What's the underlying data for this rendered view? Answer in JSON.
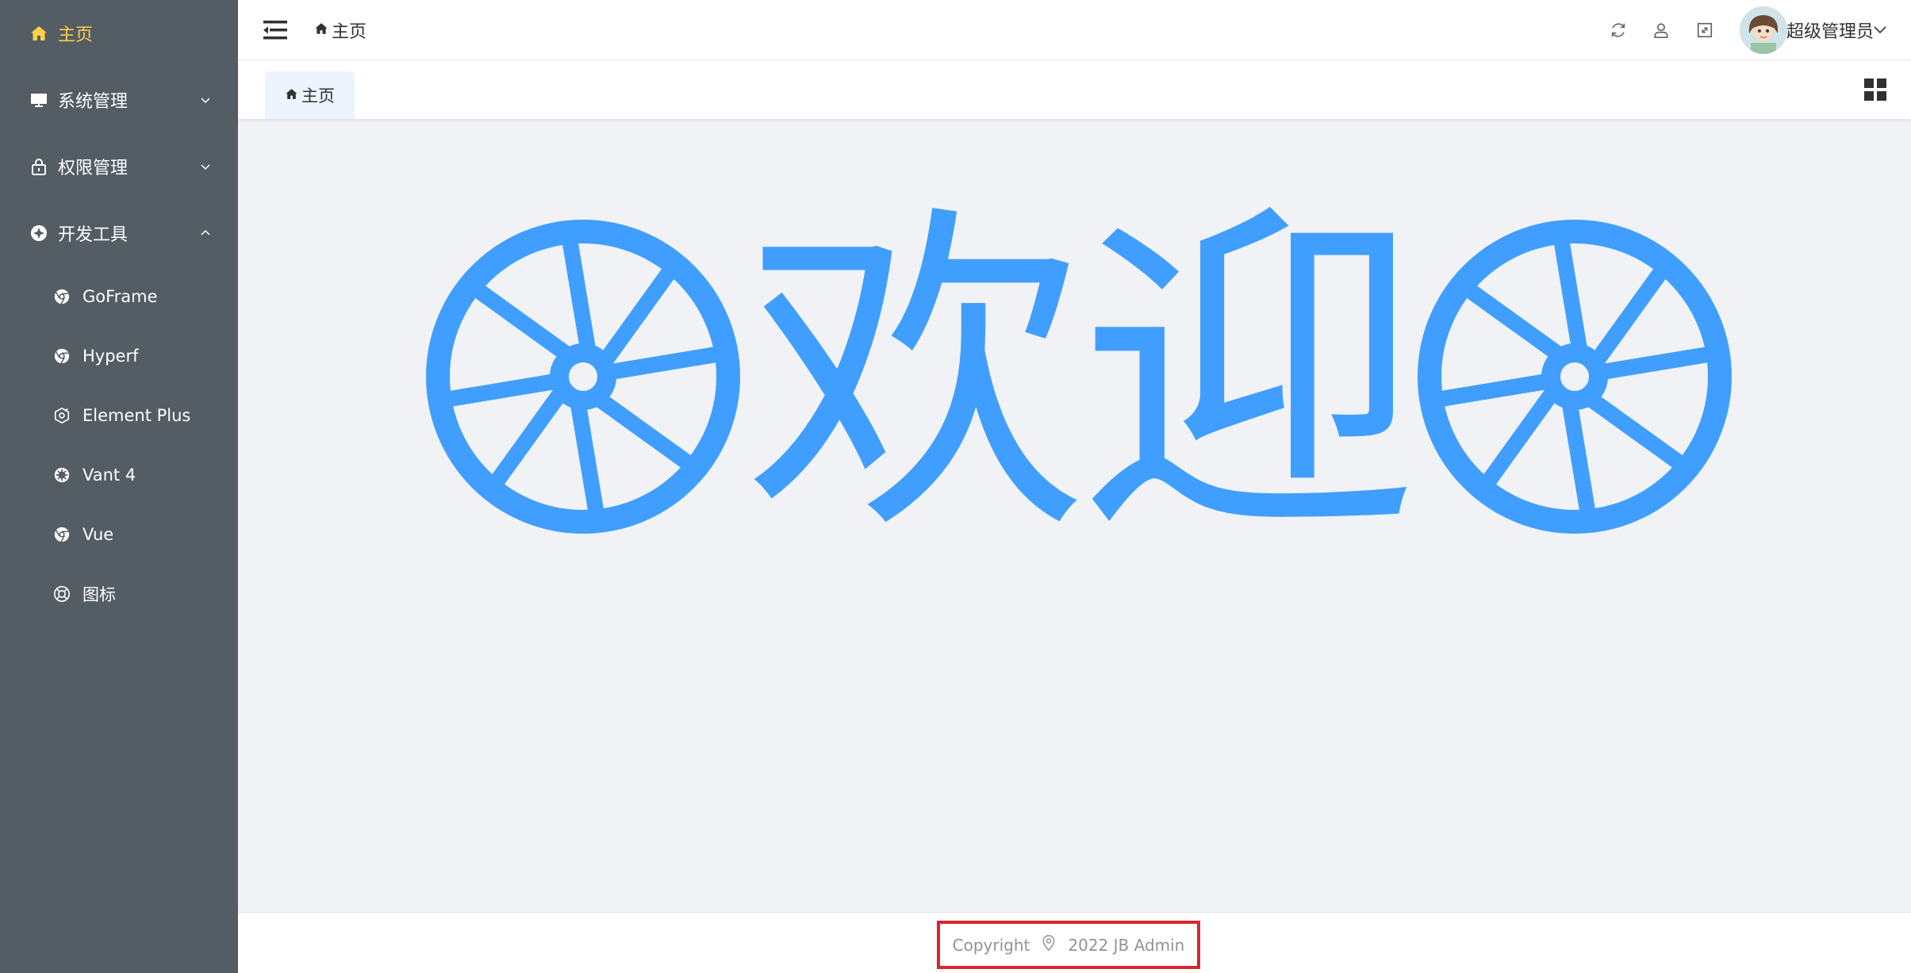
{
  "sidebar": {
    "items": [
      {
        "label": "主页",
        "icon": "home-icon",
        "active": true
      },
      {
        "label": "系统管理",
        "icon": "monitor-icon",
        "expanded": false
      },
      {
        "label": "权限管理",
        "icon": "lock-icon",
        "expanded": false
      },
      {
        "label": "开发工具",
        "icon": "tools-icon",
        "expanded": true
      }
    ],
    "subitems": [
      {
        "label": "GoFrame",
        "icon": "chrome-icon"
      },
      {
        "label": "Hyperf",
        "icon": "chrome-icon"
      },
      {
        "label": "Element Plus",
        "icon": "element-plus-icon"
      },
      {
        "label": "Vant 4",
        "icon": "gear-circle-icon"
      },
      {
        "label": "Vue",
        "icon": "chrome-icon"
      },
      {
        "label": "图标",
        "icon": "lifebuoy-icon"
      }
    ],
    "colors": {
      "background": "#545c64",
      "text": "#ffffff",
      "active": "#ffd04b"
    }
  },
  "header": {
    "breadcrumb": "主页",
    "username": "超级管理员",
    "icons": [
      "refresh-icon",
      "user-icon",
      "fullscreen-icon"
    ]
  },
  "tabs": [
    {
      "label": "主页",
      "active": true
    }
  ],
  "main": {
    "welcome_text": "欢迎",
    "accent": "#409eff"
  },
  "footer": {
    "copyright_label": "Copyright",
    "copyright_text": "2022 JB Admin"
  }
}
